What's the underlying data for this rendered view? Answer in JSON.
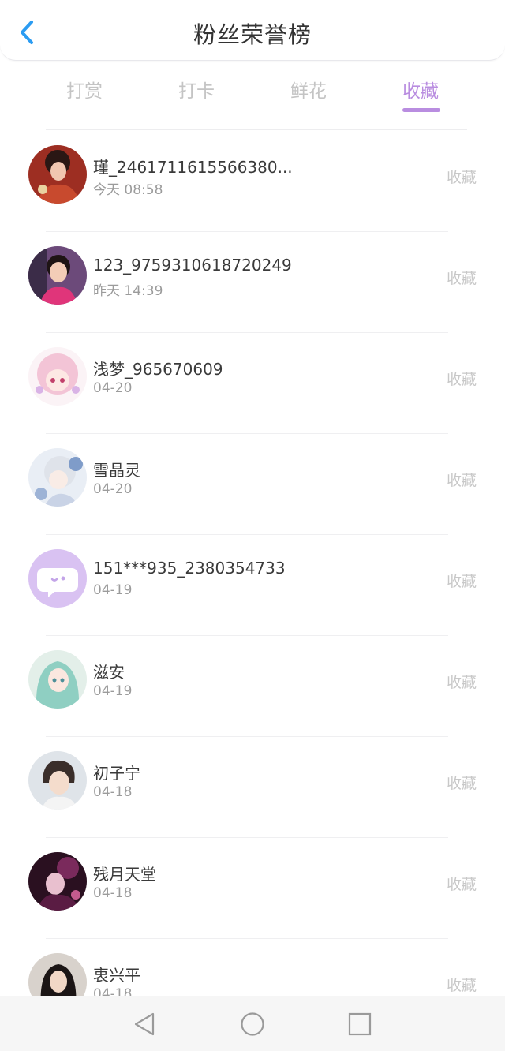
{
  "header": {
    "title": "粉丝荣誉榜"
  },
  "tabs": [
    {
      "label": "打赏",
      "active": false
    },
    {
      "label": "打卡",
      "active": false
    },
    {
      "label": "鲜花",
      "active": false
    },
    {
      "label": "收藏",
      "active": true
    }
  ],
  "colors": {
    "accent": "#b98de0",
    "back": "#2b9cf2"
  },
  "fans": [
    {
      "name": "瑾_2461711615566380...",
      "time": "今天 08:58",
      "action": "收藏"
    },
    {
      "name": "123_9759310618720249",
      "time": "昨天 14:39",
      "action": "收藏"
    },
    {
      "name": "浅梦_965670609",
      "time": "04-20",
      "action": "收藏"
    },
    {
      "name": "雪晶灵",
      "time": "04-20",
      "action": "收藏"
    },
    {
      "name": "151***935_2380354733",
      "time": "04-19",
      "action": "收藏"
    },
    {
      "name": "滋安",
      "time": "04-19",
      "action": "收藏"
    },
    {
      "name": "初子宁",
      "time": "04-18",
      "action": "收藏"
    },
    {
      "name": "残月天堂",
      "time": "04-18",
      "action": "收藏"
    },
    {
      "name": "衷兴平",
      "time": "04-18",
      "action": "收藏"
    }
  ],
  "navbar": {
    "icons": [
      "back-triangle-icon",
      "home-circle-icon",
      "recents-square-icon"
    ]
  }
}
